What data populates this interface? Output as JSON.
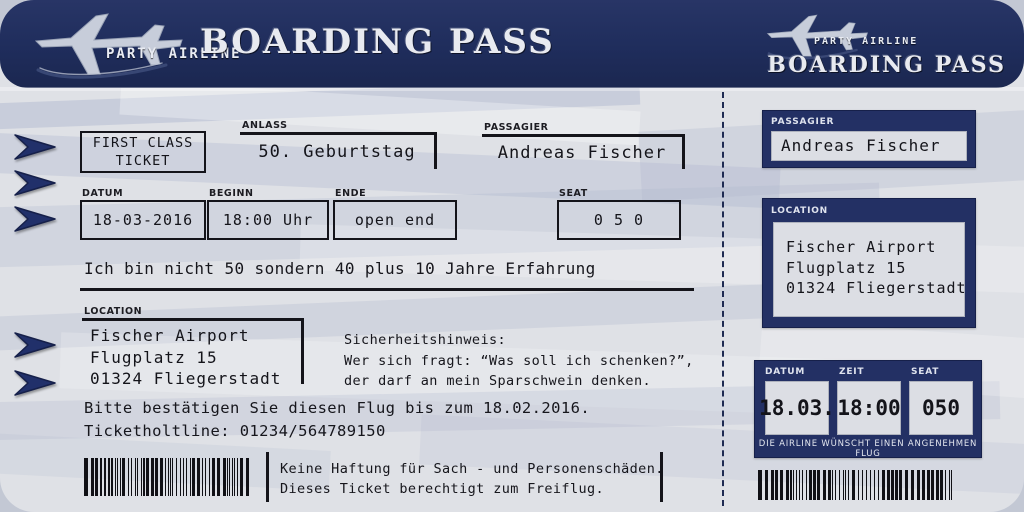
{
  "header": {
    "brand": "PARTY AIRLINE",
    "title": "BOARDING PASS",
    "stub_title": "BOARDING PASS",
    "plane_icon": "airplane-icon",
    "navy": "#1f2d5c",
    "paper": "#dfe1e6"
  },
  "main": {
    "class_box": "FIRST CLASS\nTICKET",
    "fields": {
      "anlass": {
        "label": "ANLASS",
        "value": "50. Geburtstag"
      },
      "passagier": {
        "label": "PASSAGIER",
        "value": "Andreas Fischer"
      },
      "datum": {
        "label": "DATUM",
        "value": "18-03-2016"
      },
      "beginn": {
        "label": "BEGINN",
        "value": "18:00 Uhr"
      },
      "ende": {
        "label": "ENDE",
        "value": "open end"
      },
      "seat": {
        "label": "SEAT",
        "value": "0 5 0"
      },
      "location": {
        "label": "LOCATION",
        "value": "Fischer Airport\nFlugplatz 15\n01324 Fliegerstadt"
      }
    },
    "slogan": "Ich bin nicht 50 sondern 40 plus 10 Jahre Erfahrung",
    "security_note": "Sicherheitshinweis:\nWer sich fragt: “Was soll ich schenken?”,\nder darf an mein Sparschwein denken.",
    "confirm_line": "Bitte bestätigen Sie diesen Flug bis zum 18.02.2016.",
    "hotline_line": "Ticketholtline: 01234/564789150",
    "disclaimer": "Keine Haftung für Sach - und Personenschäden.\nDieses Ticket berechtigt zum Freiflug.",
    "barcode_name": "barcode"
  },
  "stub": {
    "passagier": {
      "label": "PASSAGIER",
      "value": "Andreas Fischer"
    },
    "location": {
      "label": "LOCATION",
      "value": "Fischer Airport\nFlugplatz 15\n01324 Fliegerstadt"
    },
    "datum": {
      "label": "DATUM",
      "value": "18.03."
    },
    "zeit": {
      "label": "ZEIT",
      "value": "18:00"
    },
    "seat": {
      "label": "SEAT",
      "value": "050"
    },
    "footer": "DIE AIRLINE WÜNSCHT EINEN ANGENEHMEN FLUG",
    "barcode_name": "stub-barcode"
  },
  "decor": {
    "chevron_icon": "chevron-right-icon",
    "chevron_count": 5,
    "perforation": "perforation-line"
  }
}
